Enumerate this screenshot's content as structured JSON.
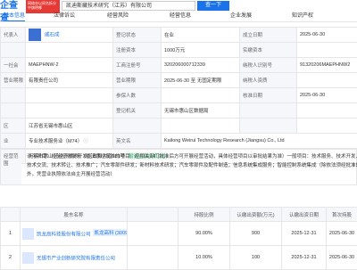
{
  "header": {
    "logo": "企查查",
    "promo": "网络亦以同名拆分中旗明哪",
    "search_value": "凯迪斯藏技术研究（江苏）有限公司",
    "search_button": "查一下"
  },
  "tabs": [
    {
      "label": "基本信息",
      "count": "",
      "active": true
    },
    {
      "label": "法律诉讼",
      "count": "",
      "active": false
    },
    {
      "label": "经营风险",
      "count": "",
      "active": false
    },
    {
      "label": "经营信息",
      "count": "",
      "active": false
    },
    {
      "label": "企业发展",
      "count": "",
      "active": false
    },
    {
      "label": "知识产权",
      "count": "",
      "active": false
    }
  ],
  "info": {
    "r1": {
      "l1": "代表人",
      "person": "戚石成",
      "l2": "登记状态",
      "v2": "在业",
      "l3": "成立日期",
      "v3": "2025-06-30"
    },
    "r2": {
      "l2": "注册资本",
      "v2": "1000万元",
      "l3": "实缴资本",
      "v3": ""
    },
    "r3": {
      "l1": "一社会",
      "v1": "MAEPHNW-2",
      "l2": "工商注册号",
      "v2": "320206000712339",
      "l3": "纳税人识别号",
      "v3": "91320206MAEPHNW2"
    },
    "r4": {
      "l1": "营业期限",
      "v1": "有限责任公司",
      "l2": "营业期限",
      "v2": "2025-06-30 至 无固定期限",
      "l3": "纳税人资质",
      "v3": ""
    },
    "r5": {
      "l1": "",
      "v1": "",
      "l2": "参保人数",
      "v2": "",
      "l3": "核准日期",
      "v3": "2025-06-30"
    },
    "r6": {
      "l1": "",
      "v1": "",
      "l2": "登记机关",
      "v2": "无锡市惠山区数据局",
      "l3": "",
      "v3": ""
    },
    "r7": {
      "l1": "区",
      "v1": "江苏省无锡市惠山区",
      "l2": "",
      "v2": "",
      "l3": "",
      "v3": ""
    },
    "r8": {
      "l1": "业",
      "v1": "专业技术服务业（M74）",
      "info": "ⓘ",
      "l2": "英文名",
      "v2": "Kailong Weirui Technology Research (Jiangsu) Co., Ltd",
      "l3": "",
      "v3": ""
    },
    "r9": {
      "l1": "地址",
      "v1": "无锡市惠山区经济技术开发区政和大道181号",
      "tag": "附近企业(14100)",
      "l2": "",
      "v2": "",
      "l3": "",
      "v3": ""
    }
  },
  "business": {
    "label": "经营范围",
    "lines": [
      "许可项目：检验检测服务（依法须经批准的项目，经相关部门批准后方可开展经营活动，具体经营项目以审批结果为准）一般项目：技术服务、技术开发、技术咨询、",
      "技术交流、技术转让、技术推广；汽车零部件研发；新材料技术研发；汽车零部件及配件制造；信息系统集成服务；智能控制系统集成（除依法须经批准的项目",
      "外，凭营业执照依法自主开展经营活动）"
    ]
  },
  "shareholders": {
    "headers": [
      "",
      "股东名称",
      "",
      "持股比例",
      "认缴出资额(万元)",
      "认缴出资日期",
      "首次持股"
    ],
    "rows": [
      {
        "idx": "1",
        "name": "凯龙高科技股份有限公司",
        "badge": "凯龙高科 (300912.SZ)",
        "ratio": "90.00%",
        "amount": "900",
        "date": "2025-12-31",
        "first": "2025-06-30"
      },
      {
        "idx": "2",
        "name": "无锡市产业创新研究院有限责任公司",
        "badge": "",
        "ratio": "10.00%",
        "amount": "100",
        "date": "2025-12-31",
        "first": "2025-06-30"
      }
    ]
  }
}
